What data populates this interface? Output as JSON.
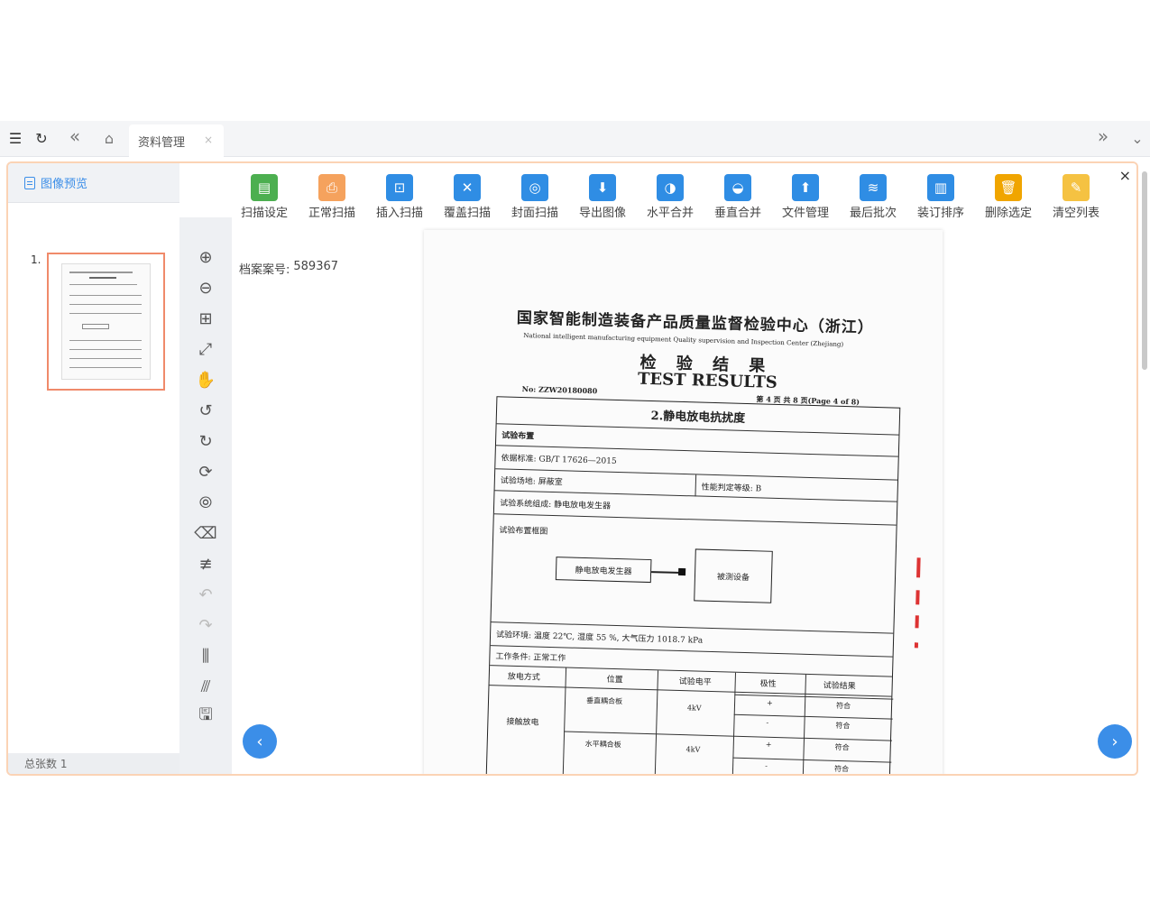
{
  "topbar": {
    "tab_label": "资料管理",
    "tab_close": "×",
    "menu_glyph": "☰",
    "refresh_glyph": "↻",
    "back_glyph": "«",
    "home_glyph": "⌂",
    "forward_glyph": "»",
    "dropdown_glyph": "⌄"
  },
  "left": {
    "header": "图像预览",
    "thumbnails": [
      {
        "number": "1."
      }
    ],
    "footer": "总张数 1"
  },
  "ribbon": [
    {
      "label": "扫描设定",
      "icon": "scan-settings-icon",
      "color": "#4caf50",
      "glyph": "▤"
    },
    {
      "label": "正常扫描",
      "icon": "printer-icon",
      "color": "#f5a25d",
      "glyph": "⎙"
    },
    {
      "label": "插入扫描",
      "icon": "insert-scan-icon",
      "color": "#2f8de4",
      "glyph": "⊡"
    },
    {
      "label": "覆盖扫描",
      "icon": "overwrite-scan-icon",
      "color": "#2f8de4",
      "glyph": "✕"
    },
    {
      "label": "封面扫描",
      "icon": "cover-scan-icon",
      "color": "#2f8de4",
      "glyph": "◎"
    },
    {
      "label": "导出图像",
      "icon": "export-image-icon",
      "color": "#2f8de4",
      "glyph": "⬇"
    },
    {
      "label": "水平合并",
      "icon": "horizontal-merge-icon",
      "color": "#2f8de4",
      "glyph": "◑"
    },
    {
      "label": "垂直合并",
      "icon": "vertical-merge-icon",
      "color": "#2f8de4",
      "glyph": "◒"
    },
    {
      "label": "文件管理",
      "icon": "file-manage-icon",
      "color": "#2f8de4",
      "glyph": "⬆"
    },
    {
      "label": "最后批次",
      "icon": "layers-icon",
      "color": "#2f8de4",
      "glyph": "≋"
    },
    {
      "label": "装订排序",
      "icon": "sort-books-icon",
      "color": "#2f8de4",
      "glyph": "▥"
    },
    {
      "label": "删除选定",
      "icon": "trash-icon",
      "color": "#f0a500",
      "glyph": "🗑"
    },
    {
      "label": "清空列表",
      "icon": "clear-list-icon",
      "color": "#f5c242",
      "glyph": "✎"
    }
  ],
  "close_glyph": "×",
  "tools": [
    {
      "name": "zoom-in-icon",
      "glyph": "⊕"
    },
    {
      "name": "zoom-out-icon",
      "glyph": "⊖"
    },
    {
      "name": "fit-page-icon",
      "glyph": "⊞"
    },
    {
      "name": "fullscreen-icon",
      "glyph": "⤢"
    },
    {
      "name": "hand-pan-icon",
      "glyph": "✋"
    },
    {
      "name": "rotate-left-icon",
      "glyph": "↺"
    },
    {
      "name": "rotate-right-icon",
      "glyph": "↻"
    },
    {
      "name": "rotate-icon",
      "glyph": "⟳"
    },
    {
      "name": "magic-zoom-icon",
      "glyph": "⦾"
    },
    {
      "name": "eraser-icon",
      "glyph": "⌫"
    },
    {
      "name": "not-equal-icon",
      "glyph": "≢"
    },
    {
      "name": "undo-icon",
      "glyph": "↶"
    },
    {
      "name": "redo-icon",
      "glyph": "↷"
    },
    {
      "name": "split-vertical-icon",
      "glyph": "⫼"
    },
    {
      "name": "split-horizontal-icon",
      "glyph": "⫻"
    },
    {
      "name": "save-icon",
      "glyph": "🖫"
    }
  ],
  "main": {
    "case_label": "档案案号:",
    "case_number": "589367",
    "prev_glyph": "‹",
    "next_glyph": "›"
  },
  "document": {
    "title": "国家智能制造装备产品质量监督检验中心（浙江）",
    "subtitle": "National intelligent manufacturing equipment Quality supervision and Inspection Center (Zhejiang)",
    "cn_results": "检 验 结 果",
    "en_results": "TEST RESULTS",
    "number": "No: ZZW20180080",
    "page": "第 4 页 共 8 页(Page 4 of 8)",
    "section": "2.静电放电抗扰度",
    "rows": [
      "试验布置",
      "依据标准: GB/T 17626—2015",
      "试验场地: 屏蔽室",
      "试验系统组成: 静电放电发生器",
      "试验布置框图",
      "试验环境: 温度 22℃, 湿度 55 %, 大气压力 1018.7 kPa",
      "工作条件: 正常工作"
    ],
    "grade": "性能判定等级: B",
    "box_left": "静电放电发生器",
    "box_right": "被测设备",
    "headers": [
      "放电方式",
      "位置",
      "试验电平",
      "极性",
      "试验结果"
    ],
    "method": "接触放电",
    "positions": [
      "垂直耦合板",
      "水平耦合板"
    ],
    "level": "4kV",
    "polarities": [
      "+",
      "-",
      "+",
      "-"
    ],
    "results": [
      "符合",
      "符合",
      "符合",
      "符合"
    ]
  }
}
